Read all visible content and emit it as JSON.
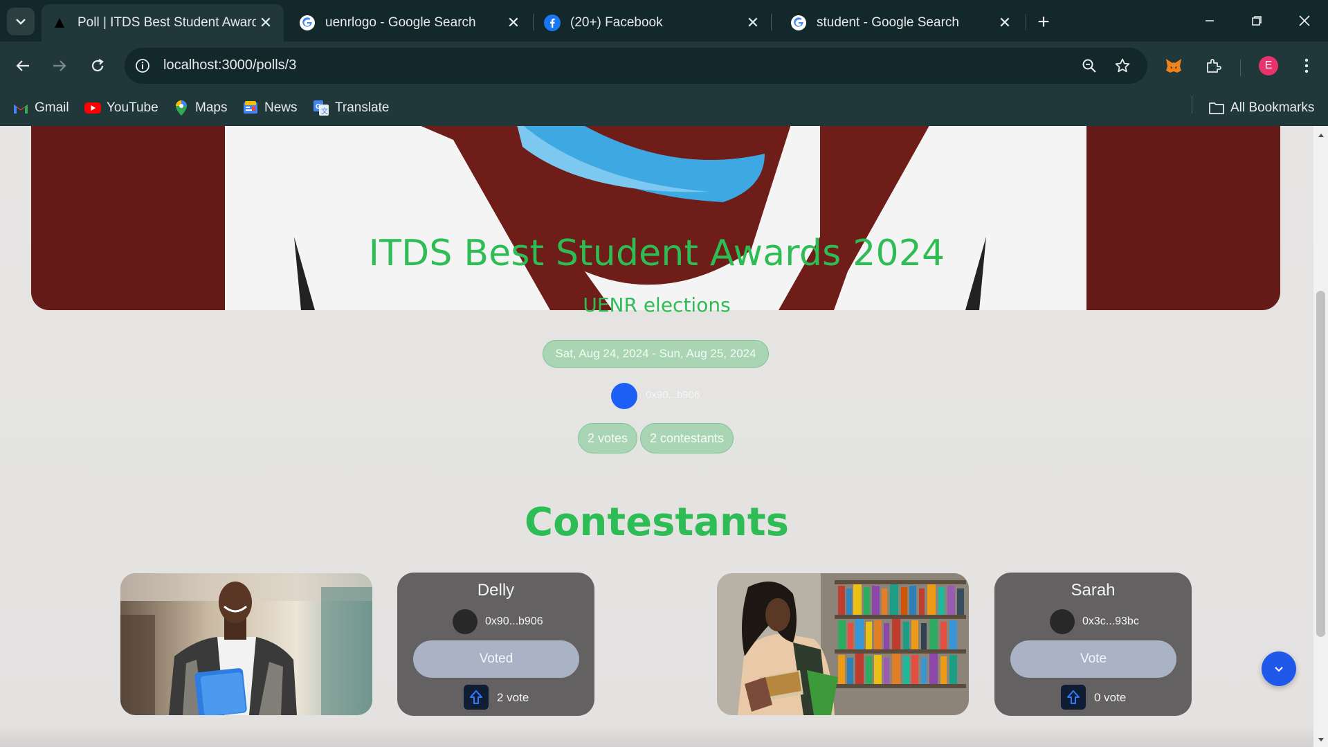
{
  "browser": {
    "tabs": [
      {
        "title": "Poll | ITDS Best Student Awards",
        "icon": "triangle-favicon",
        "active": true
      },
      {
        "title": "uenrlogo - Google Search",
        "icon": "google-icon",
        "active": false
      },
      {
        "title": "(20+) Facebook",
        "icon": "facebook-icon",
        "active": false
      },
      {
        "title": "student - Google Search",
        "icon": "google-icon",
        "active": false
      }
    ],
    "url": "localhost:3000/polls/3",
    "profile_initial": "E",
    "bookmarks": [
      {
        "label": "Gmail",
        "icon": "gmail-icon"
      },
      {
        "label": "YouTube",
        "icon": "youtube-icon"
      },
      {
        "label": "Maps",
        "icon": "maps-icon"
      },
      {
        "label": "News",
        "icon": "news-icon"
      },
      {
        "label": "Translate",
        "icon": "translate-icon"
      }
    ],
    "all_bookmarks_label": "All Bookmarks"
  },
  "poll": {
    "title": "ITDS Best Student Awards 2024",
    "subtitle": "UENR elections",
    "date_range": "Sat, Aug 24, 2024 - Sun, Aug 25, 2024",
    "creator_address": "0x90...b906",
    "votes_label": "2 votes",
    "contestants_label": "2 contestants"
  },
  "contestants_section": {
    "title": "Contestants",
    "items": [
      {
        "name": "Delly",
        "address": "0x90...b906",
        "button_label": "Voted",
        "votes_label": "2 vote",
        "photo": "student-with-folder-photo"
      },
      {
        "name": "Sarah",
        "address": "0x3c...93bc",
        "button_label": "Vote",
        "votes_label": "0 vote",
        "photo": "student-in-library-photo"
      }
    ]
  },
  "colors": {
    "accent_green": "#2ebc55",
    "chrome_dark": "#13282a",
    "chrome_mid": "#20383a",
    "card_grey": "#636161",
    "fab_blue": "#2059ea"
  }
}
